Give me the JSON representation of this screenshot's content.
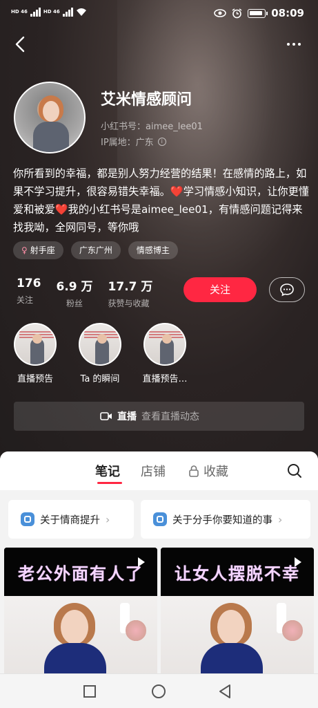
{
  "status_bar": {
    "sim1": "HD 46",
    "sim2": "HD 46",
    "time": "08:09"
  },
  "profile": {
    "name": "艾米情感顾问",
    "red_id": "小红书号：aimee_lee01",
    "ip_location": "IP属地：广东",
    "bio": "你所看到的幸福，都是别人努力经营的结果！在感情的路上，如果不学习提升，很容易错失幸福。❤️学习情感小知识，让你更懂爱和被爱❤️我的小红书号是aimee_lee01，有情感问题记得来找我呦，全网同号，等你哦",
    "tags": [
      "射手座",
      "广东广州",
      "情感博主"
    ],
    "female_symbol": "♀"
  },
  "stats": [
    {
      "value": "176",
      "label": "关注"
    },
    {
      "value": "6.9 万",
      "label": "粉丝"
    },
    {
      "value": "17.7 万",
      "label": "获赞与收藏"
    }
  ],
  "actions": {
    "follow_label": "关注"
  },
  "highlights": [
    {
      "label": "直播预告"
    },
    {
      "label": "Ta 的瞬间"
    },
    {
      "label": "直播预告…"
    }
  ],
  "live": {
    "label": "直播",
    "subtitle": "查看直播动态"
  },
  "tabs": [
    {
      "label": "笔记"
    },
    {
      "label": "店铺"
    },
    {
      "label": "收藏"
    }
  ],
  "collections": [
    {
      "label": "关于情商提升"
    },
    {
      "label": "关于分手你要知道的事"
    }
  ],
  "notes": [
    {
      "title": "老公外面有人了"
    },
    {
      "title": "让女人摆脱不幸"
    }
  ],
  "colors": {
    "accent": "#ff2742",
    "header_bg": "#2a2323"
  }
}
